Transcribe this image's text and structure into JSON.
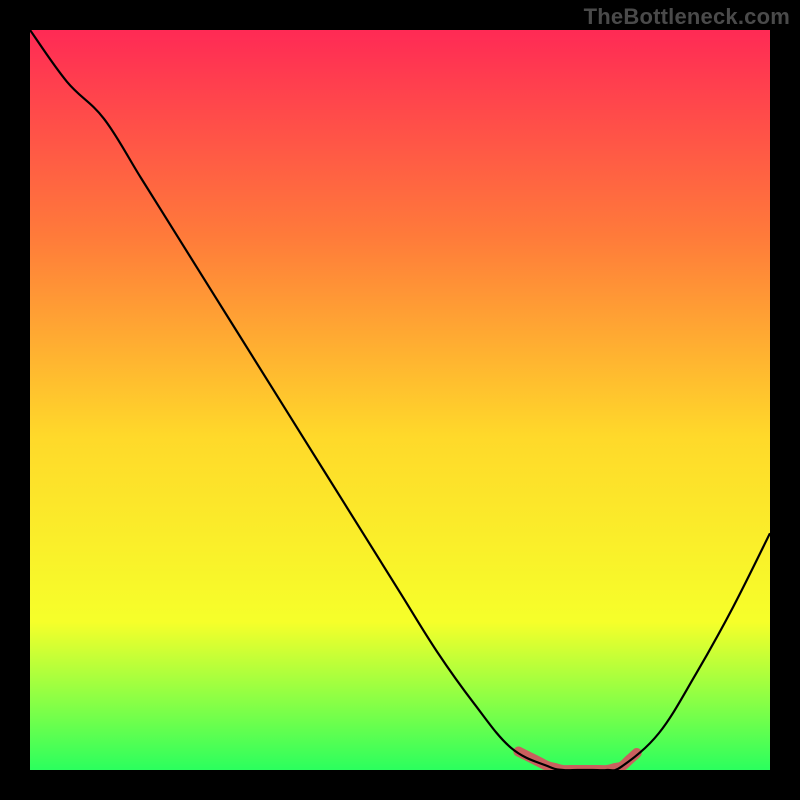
{
  "watermark": "TheBottleneck.com",
  "chart_data": {
    "type": "line",
    "title": "",
    "xlabel": "",
    "ylabel": "",
    "x": [
      0,
      5,
      10,
      15,
      20,
      25,
      30,
      35,
      40,
      45,
      50,
      55,
      60,
      65,
      70,
      72,
      74,
      76,
      78,
      80,
      85,
      90,
      95,
      100
    ],
    "values": [
      100,
      93,
      88,
      80,
      72,
      64,
      56,
      48,
      40,
      32,
      24,
      16,
      9,
      3,
      0.5,
      0,
      0,
      0,
      0,
      0.5,
      5,
      13,
      22,
      32
    ],
    "xlim": [
      0,
      100
    ],
    "ylim": [
      0,
      100
    ],
    "highlight_range_x": [
      66,
      82
    ],
    "background_gradient": {
      "top": "#ff2a55",
      "mid_upper": "#ff7b3a",
      "mid": "#ffd92a",
      "mid_lower": "#f6ff2a",
      "bottom": "#2bff5e"
    }
  }
}
